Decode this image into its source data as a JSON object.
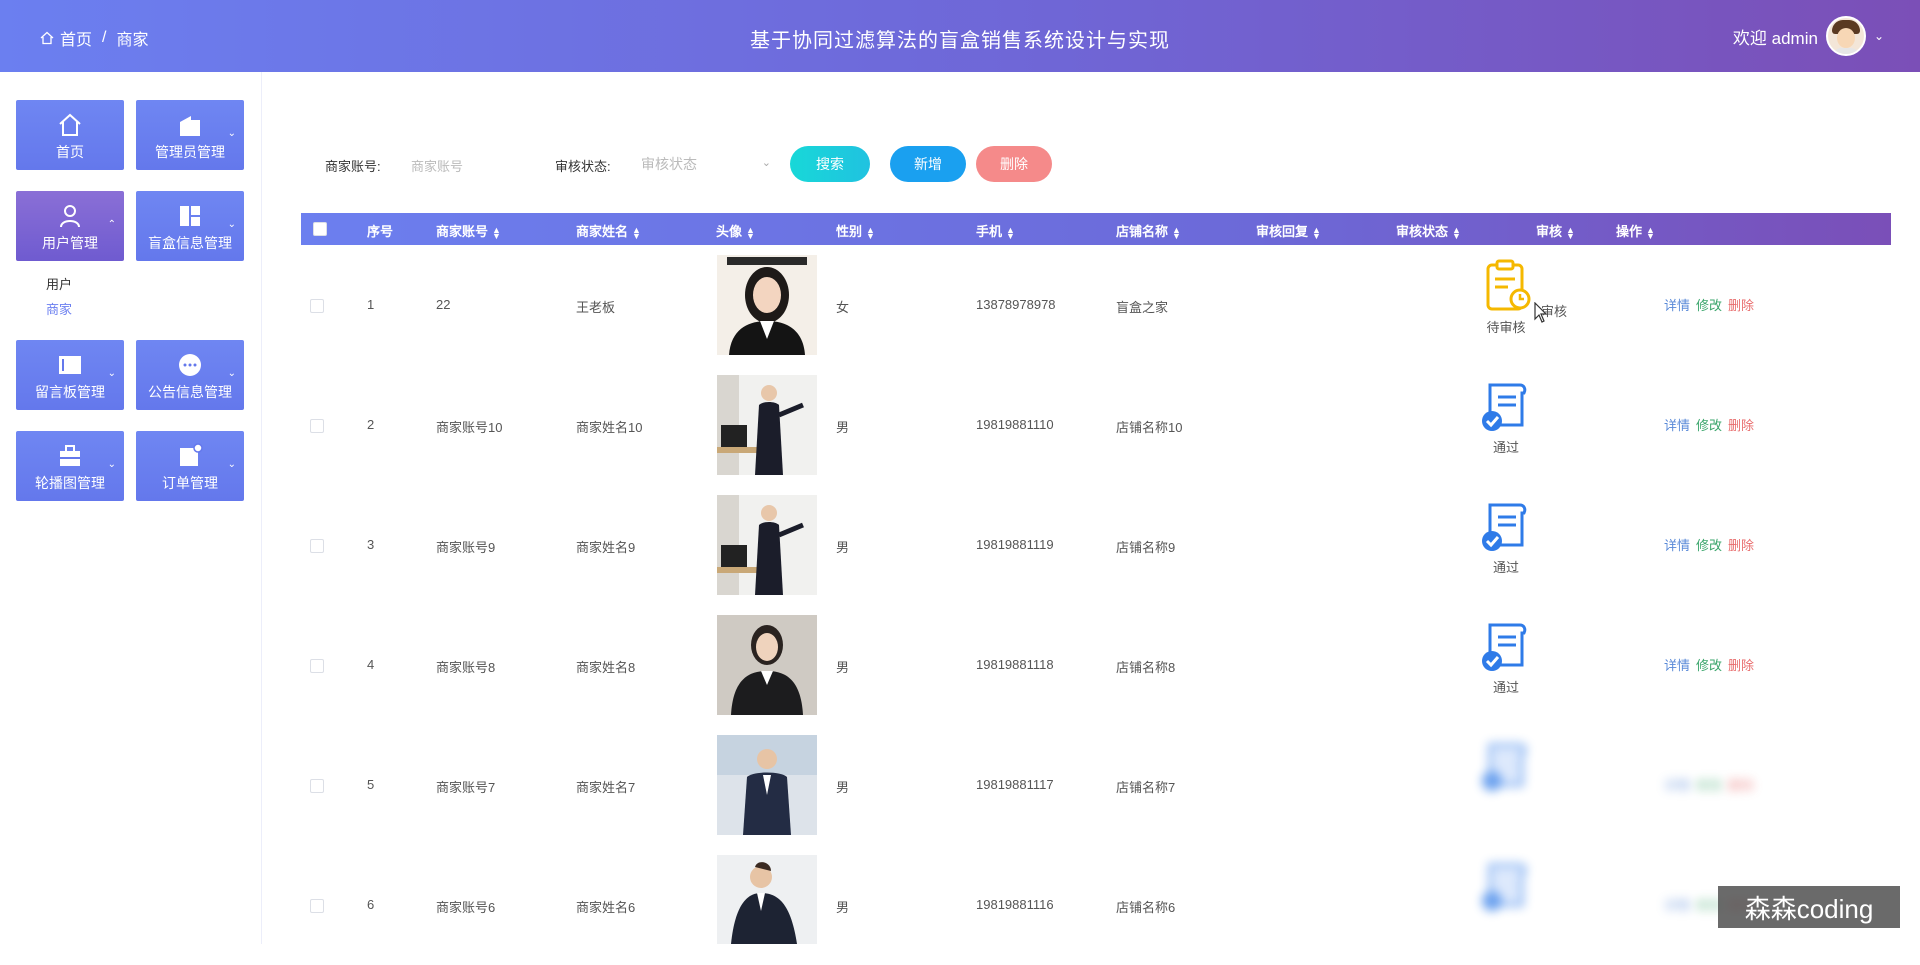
{
  "header": {
    "breadcrumb": {
      "home": "首页",
      "separator": "/",
      "current": "商家"
    },
    "title": "基于协同过滤算法的盲盒销售系统设计与实现",
    "welcome": "欢迎 admin"
  },
  "sidebar": {
    "tiles": [
      {
        "label": "首页",
        "icon": "home-icon"
      },
      {
        "label": "管理员管理",
        "icon": "admin-icon"
      },
      {
        "label": "用户管理",
        "icon": "user-icon"
      },
      {
        "label": "盲盒信息管理",
        "icon": "layout-icon"
      },
      {
        "label": "留言板管理",
        "icon": "board-icon"
      },
      {
        "label": "公告信息管理",
        "icon": "notice-icon"
      },
      {
        "label": "轮播图管理",
        "icon": "carousel-icon"
      },
      {
        "label": "订单管理",
        "icon": "order-icon"
      }
    ],
    "submenu": [
      {
        "label": "用户"
      },
      {
        "label": "商家"
      }
    ]
  },
  "search": {
    "account_label": "商家账号:",
    "account_placeholder": "商家账号",
    "status_label": "审核状态:",
    "status_placeholder": "审核状态",
    "search_button": "搜索",
    "add_button": "新增",
    "delete_button": "删除"
  },
  "table": {
    "columns": [
      "序号",
      "商家账号",
      "商家姓名",
      "头像",
      "性别",
      "手机",
      "店铺名称",
      "审核回复",
      "审核状态",
      "审核",
      "操作"
    ],
    "rows": [
      {
        "no": "1",
        "account": "22",
        "name": "王老板",
        "gender": "女",
        "phone": "13878978978",
        "shop": "盲盒之家",
        "status": "待审核",
        "audit": "审核"
      },
      {
        "no": "2",
        "account": "商家账号10",
        "name": "商家姓名10",
        "gender": "男",
        "phone": "19819881110",
        "shop": "店铺名称10",
        "status": "通过",
        "audit": ""
      },
      {
        "no": "3",
        "account": "商家账号9",
        "name": "商家姓名9",
        "gender": "男",
        "phone": "19819881119",
        "shop": "店铺名称9",
        "status": "通过",
        "audit": ""
      },
      {
        "no": "4",
        "account": "商家账号8",
        "name": "商家姓名8",
        "gender": "男",
        "phone": "19819881118",
        "shop": "店铺名称8",
        "status": "通过",
        "audit": ""
      },
      {
        "no": "5",
        "account": "商家账号7",
        "name": "商家姓名7",
        "gender": "男",
        "phone": "19819881117",
        "shop": "店铺名称7",
        "status": "",
        "audit": ""
      },
      {
        "no": "6",
        "account": "商家账号6",
        "name": "商家姓名6",
        "gender": "男",
        "phone": "19819881116",
        "shop": "店铺名称6",
        "status": "",
        "audit": ""
      }
    ],
    "actions": {
      "detail": "详情",
      "edit": "修改",
      "delete": "删除"
    }
  },
  "watermark": "森森coding",
  "colors": {
    "accent": "#6b7ff0",
    "purple": "#7a4fb8",
    "search_btn": "#18d3d3",
    "add_btn": "#1aa0f0",
    "del_btn": "#f58a8a",
    "detail": "#5a8ad8",
    "edit": "#3aa56b",
    "remove": "#e86b6b",
    "pending": "#f5b800",
    "pass": "#2f7be8"
  }
}
